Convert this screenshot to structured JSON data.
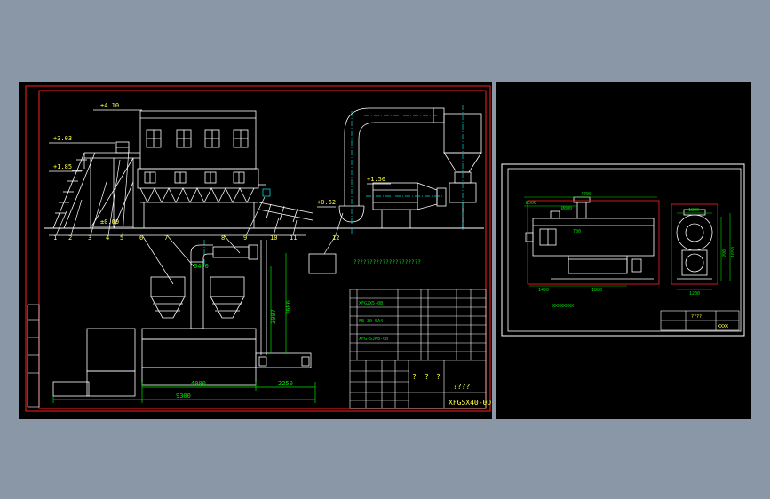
{
  "colors": {
    "background": "#8a97a6",
    "canvas": "#000000",
    "frame": "#ff2020",
    "line": "#ffffff",
    "center": "#00d8d8",
    "dim": "#00e000",
    "text_yellow": "#ffff40"
  },
  "main_sheet": {
    "elevations": [
      "±4.10",
      "+3.03",
      "+1.85",
      "±0.00",
      "+1.50",
      "+0.62"
    ],
    "part_numbers": [
      "1",
      "2",
      "3",
      "4",
      "5",
      "6",
      "7",
      "8",
      "9",
      "10",
      "11",
      "12"
    ],
    "dimensions": {
      "d1": "Ø400",
      "d2": "3007",
      "d3": "3686",
      "d4": "4000",
      "d5": "2250",
      "d6": "9300"
    },
    "note": "?????????????????????",
    "title_block": {
      "part_rows": [
        "XFG2X5-0B",
        "FB-30-5A4",
        "XFG-SJM8-0B"
      ],
      "marks": [
        "?",
        "?",
        "?"
      ],
      "drawing_name": "????",
      "drawing_code": "XFG5X40-0D"
    }
  },
  "side_sheet": {
    "dimensions": {
      "d1": "4700",
      "d2": "Ø500",
      "d3": "Ø800",
      "d4": "1450",
      "d5": "1880",
      "d6": "1800",
      "d7": "700",
      "d8": "990",
      "d9": "1650",
      "d10": "1200"
    },
    "small_label": "XXXXXXXX",
    "title_block": {
      "name": "????",
      "code": "XXXX"
    }
  }
}
